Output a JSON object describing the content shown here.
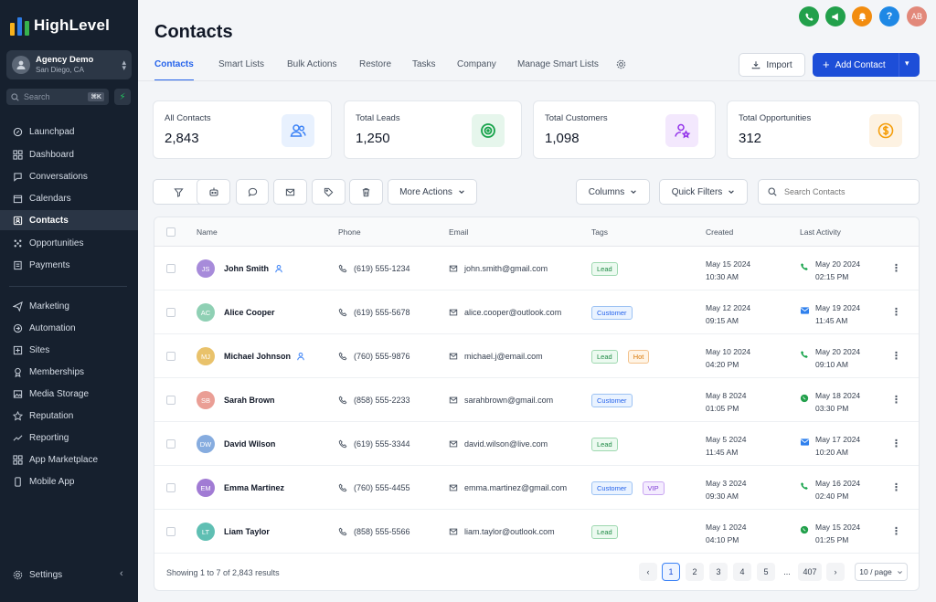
{
  "app": {
    "name": "HighLevel"
  },
  "account": {
    "name": "Agency Demo",
    "location": "San Diego, CA"
  },
  "sidebar": {
    "search_placeholder": "Search",
    "search_shortcut": "⌘K",
    "items": [
      {
        "label": "Launchpad",
        "icon": "rocket-icon"
      },
      {
        "label": "Dashboard",
        "icon": "dashboard-icon"
      },
      {
        "label": "Conversations",
        "icon": "chat-icon"
      },
      {
        "label": "Calendars",
        "icon": "calendar-icon"
      },
      {
        "label": "Contacts",
        "icon": "contacts-icon",
        "active": true
      },
      {
        "label": "Opportunities",
        "icon": "opportunities-icon"
      },
      {
        "label": "Payments",
        "icon": "payments-icon"
      },
      {
        "label": "Marketing",
        "icon": "send-icon"
      },
      {
        "label": "Automation",
        "icon": "automation-icon"
      },
      {
        "label": "Sites",
        "icon": "sites-icon"
      },
      {
        "label": "Memberships",
        "icon": "memberships-icon"
      },
      {
        "label": "Media Storage",
        "icon": "media-icon"
      },
      {
        "label": "Reputation",
        "icon": "star-icon"
      },
      {
        "label": "Reporting",
        "icon": "trend-icon"
      },
      {
        "label": "App Marketplace",
        "icon": "grid-icon"
      },
      {
        "label": "Mobile App",
        "icon": "mobile-icon"
      }
    ],
    "settings_label": "Settings"
  },
  "header": {
    "title": "Contacts",
    "tabs": [
      "Contacts",
      "Smart Lists",
      "Bulk Actions",
      "Restore",
      "Tasks",
      "Company",
      "Manage Smart Lists"
    ],
    "import_label": "Import",
    "add_contact_label": "Add Contact",
    "user_initials": "AB"
  },
  "stats": [
    {
      "label": "All Contacts",
      "value": "2,843",
      "icon": "users-icon",
      "color": "#3b82f6"
    },
    {
      "label": "Total Leads",
      "value": "1,250",
      "icon": "target-icon",
      "color": "#16a34a"
    },
    {
      "label": "Total Customers",
      "value": "1,098",
      "icon": "user-star-icon",
      "color": "#9333ea"
    },
    {
      "label": "Total Opportunities",
      "value": "312",
      "icon": "dollar-icon",
      "color": "#f59e0b"
    }
  ],
  "toolbar": {
    "more_actions": "More Actions",
    "columns": "Columns",
    "quick_filters": "Quick Filters",
    "search_placeholder": "Search Contacts"
  },
  "table": {
    "columns": [
      "Name",
      "Phone",
      "Email",
      "Tags",
      "Created",
      "Last Activity"
    ],
    "rows": [
      {
        "initials": "JS",
        "name": "John Smith",
        "assigned": true,
        "color": "#a78bda",
        "phone": "(619) 555-1234",
        "email": "john.smith@gmail.com",
        "tags": [
          "Lead"
        ],
        "created_date": "May 15 2024",
        "created_time": "10:30 AM",
        "activity_type": "call",
        "activity_date": "May 20 2024",
        "activity_time": "02:15 PM"
      },
      {
        "initials": "AC",
        "name": "Alice Cooper",
        "assigned": false,
        "color": "#8fd0b4",
        "phone": "(619) 555-5678",
        "email": "alice.cooper@outlook.com",
        "tags": [
          "Customer"
        ],
        "created_date": "May 12 2024",
        "created_time": "09:15 AM",
        "activity_type": "email",
        "activity_date": "May 19 2024",
        "activity_time": "11:45 AM"
      },
      {
        "initials": "MJ",
        "name": "Michael Johnson",
        "assigned": true,
        "color": "#e9c26b",
        "phone": "(760) 555-9876",
        "email": "michael.j@email.com",
        "tags": [
          "Lead",
          "Hot"
        ],
        "created_date": "May 10 2024",
        "created_time": "04:20 PM",
        "activity_type": "call",
        "activity_date": "May 20 2024",
        "activity_time": "09:10 AM"
      },
      {
        "initials": "SB",
        "name": "Sarah Brown",
        "assigned": false,
        "color": "#ea9e95",
        "phone": "(858) 555-2233",
        "email": "sarahbrown@gmail.com",
        "tags": [
          "Customer"
        ],
        "created_date": "May 8 2024",
        "created_time": "01:05 PM",
        "activity_type": "whatsapp",
        "activity_date": "May 18 2024",
        "activity_time": "03:30 PM"
      },
      {
        "initials": "DW",
        "name": "David Wilson",
        "assigned": false,
        "color": "#86acdf",
        "phone": "(619) 555-3344",
        "email": "david.wilson@live.com",
        "tags": [
          "Lead"
        ],
        "created_date": "May 5 2024",
        "created_time": "11:45 AM",
        "activity_type": "email",
        "activity_date": "May 17 2024",
        "activity_time": "10:20 AM"
      },
      {
        "initials": "EM",
        "name": "Emma Martinez",
        "assigned": false,
        "color": "#a17bd4",
        "phone": "(760) 555-4455",
        "email": "emma.martinez@gmail.com",
        "tags": [
          "Customer",
          "VIP"
        ],
        "created_date": "May 3 2024",
        "created_time": "09:30 AM",
        "activity_type": "call",
        "activity_date": "May 16 2024",
        "activity_time": "02:40 PM"
      },
      {
        "initials": "LT",
        "name": "Liam Taylor",
        "assigned": false,
        "color": "#5fbfb3",
        "phone": "(858) 555-5566",
        "email": "liam.taylor@outlook.com",
        "tags": [
          "Lead"
        ],
        "created_date": "May 1 2024",
        "created_time": "04:10 PM",
        "activity_type": "whatsapp",
        "activity_date": "May 15 2024",
        "activity_time": "01:25 PM"
      }
    ]
  },
  "pagination": {
    "summary": "Showing 1 to 7 of 2,843 results",
    "pages": [
      "1",
      "2",
      "3",
      "4",
      "5"
    ],
    "ellipsis": "...",
    "last_page": "407",
    "per_page": "10 / page"
  }
}
